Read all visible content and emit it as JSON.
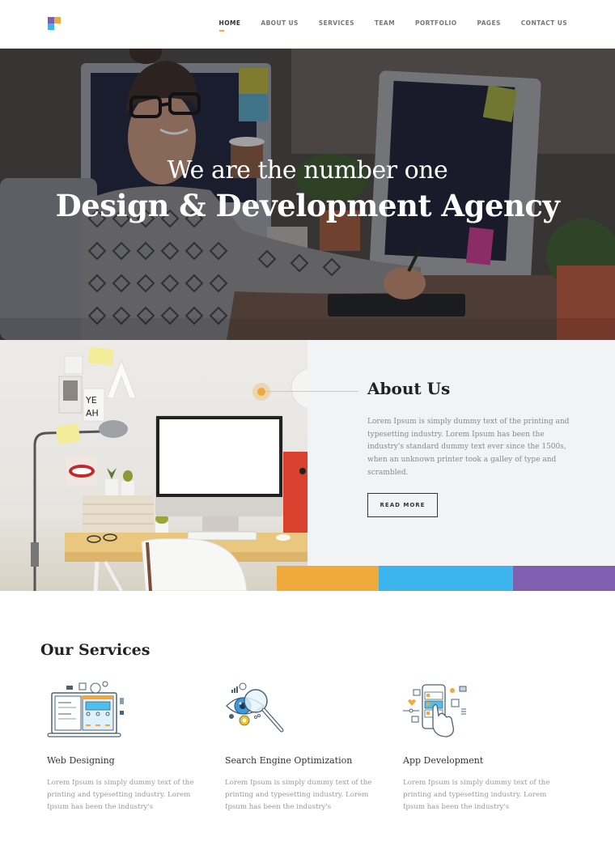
{
  "header": {
    "logo_name": "brand-logo",
    "nav": [
      {
        "label": "HOME",
        "active": true
      },
      {
        "label": "ABOUT US",
        "active": false
      },
      {
        "label": "SERVICES",
        "active": false
      },
      {
        "label": "TEAM",
        "active": false
      },
      {
        "label": "PORTFOLIO",
        "active": false
      },
      {
        "label": "PAGES",
        "active": false
      },
      {
        "label": "CONTACT US",
        "active": false
      }
    ]
  },
  "hero": {
    "subtitle": "We are the number one",
    "title": "Design & Development Agency"
  },
  "about": {
    "title": "About Us",
    "text": "Lorem Ipsum is simply dummy text of the printing and typesetting industry. Lorem Ipsum has been the industry's standard dummy text ever since the 1500s, when an unknown printer took a galley of type and scrambled.",
    "button": "READ MORE"
  },
  "colors": {
    "orange": "#f0a93b",
    "blue": "#3bb5eb",
    "purple": "#7f5fb0",
    "panel_bg": "#f2f3f5"
  },
  "services": {
    "title": "Our Services",
    "items": [
      {
        "icon": "web-design-icon",
        "name": "Web Designing",
        "text": "Lorem Ipsum is simply dummy text of the printing and typesetting industry. Lorem Ipsum has been the industry's"
      },
      {
        "icon": "seo-icon",
        "name": "Search Engine Optimization",
        "text": "Lorem Ipsum is simply dummy text of the printing and typesetting industry. Lorem Ipsum has been the industry's"
      },
      {
        "icon": "app-development-icon",
        "name": "App Development",
        "text": "Lorem Ipsum is simply dummy text of the printing and typesetting industry. Lorem Ipsum has been the industry's"
      }
    ]
  }
}
